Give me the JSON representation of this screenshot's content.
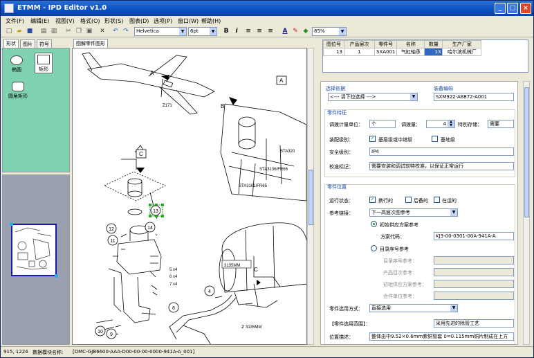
{
  "window": {
    "title": "ETMM - IPD Editor v1.0",
    "minimize": "_",
    "maximize": "□",
    "close": "×"
  },
  "menu": [
    "文件(F)",
    "编辑(E)",
    "视图(V)",
    "格式(O)",
    "形状(S)",
    "图表(D)",
    "选项(P)",
    "窗口(W)",
    "帮助(H)"
  ],
  "toolbar": {
    "font": "Helvetica",
    "size": "6pt",
    "zoom": "85%",
    "bold": "B",
    "italic": "i"
  },
  "left": {
    "tabs": [
      "形状",
      "图片",
      "符号"
    ],
    "shapes": [
      {
        "label": "椭圆"
      },
      {
        "label": "矩形"
      },
      {
        "label": "圆角矩形"
      }
    ]
  },
  "center": {
    "tab": "图解零件图形",
    "labels": {
      "A1": "A",
      "A2": "A",
      "B": "B",
      "C1": "C",
      "C2": "C",
      "z171": "Z171",
      "sta320": "STA320",
      "sta3136": "STA3136/FR66",
      "sta3101": "STA3101/FR65",
      "mm1": "3135MM",
      "mm2": "3135MM",
      "n4": "4",
      "n2": "2",
      "n8": "8",
      "n9": "9",
      "n10": "10",
      "n11": "11",
      "n12": "12",
      "n13": "13",
      "n14": "14",
      "x5": "5 x4",
      "x6": "6 x4",
      "x7": "7 x4"
    }
  },
  "right": {
    "table": {
      "headers": [
        "图位号",
        "产品层次",
        "零件号",
        "名称",
        "数量",
        "生产厂家"
      ],
      "rows": [
        [
          "13",
          "1",
          "SXA001",
          "气缸轴承",
          "13",
          "哈尔滨机械厂"
        ]
      ]
    },
    "select_label": "选择依据",
    "select_value": "<--- 请下拉选择 --->",
    "equip_label": "装备编码",
    "equip_value": "SXM922-A8872-A001",
    "part_feature": "零件特征",
    "unit_label": "调拨计量单位：",
    "unit_value": "个",
    "qty_label": "调拨量：",
    "qty_value": "4",
    "storage_label": "特别存储：",
    "storage_value": "需要",
    "assembly_label": "装配级别：",
    "assembly_opt1": "基层级或中继级",
    "assembly_opt2": "基地级",
    "safety_label": "安全级别：",
    "safety_value": "IP4",
    "calib_label": "校准标记：",
    "calib_value": "需要安装和调试前特校准，以保证正常运行",
    "position_section": "零件位置",
    "run_label": "运行状态：",
    "run_opt1": "携行的",
    "run_opt2": "后备的",
    "run_opt3": "在运的",
    "ref_label": "参考链接：",
    "ref_value": "下一高层次图参考",
    "radio1_label": "初始供应方案参考",
    "scheme_label": "方案代码：",
    "scheme_value": "KJ3-00-0301-00A-941A-A",
    "radio2_label": "目录序号参考",
    "dis1": "目录序号参考：",
    "dis2": "产品目次参考：",
    "dis3": "初始供应方案参考：",
    "dis4": "合件单位参考：",
    "select_method_label": "零件选用方式：",
    "select_method_value": "直接选用",
    "range_label": "【零件选用范围】：",
    "range_value": "采用先进的除管工艺",
    "pos_desc_label": "位置描述：",
    "pos_desc_value": "整体由中9.52×0.6mm紫铜管套 δ=0.115mm铜片制成在上方"
  },
  "status": {
    "coords": "915, 1224",
    "module_label": "数据模块名称:",
    "module_value": "[DMC-GJB6600-AAA-D00-00-00-0000-941A-A_001]"
  }
}
